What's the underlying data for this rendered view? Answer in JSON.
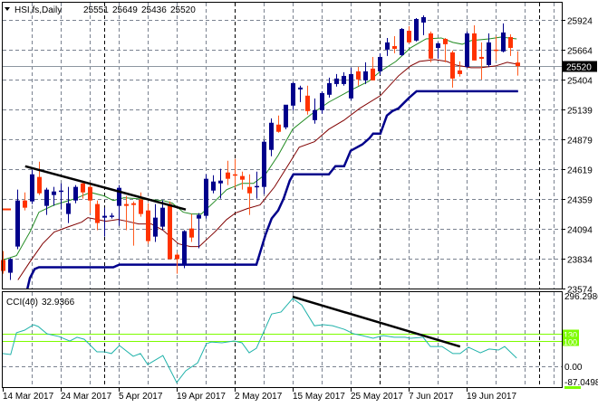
{
  "header": {
    "arrow_icon": "triangle-down-icon",
    "symbol": "HSI,fs,Daily",
    "open": "25551",
    "high": "25649",
    "low": "25436",
    "close": "25520"
  },
  "cci_label": {
    "name": "CCI(40)",
    "value": "32.9366"
  },
  "colors": {
    "bull": "#00008b",
    "bear": "#ff3300",
    "bear_wick": "#ff5a1e",
    "ma_fast": "#228b22",
    "ma_slow": "#800000",
    "stop": "#00008b",
    "cci": "#20b2aa",
    "levels": "#7cfc00",
    "trend": "#000000"
  },
  "chart_data": [
    {
      "type": "candlestick",
      "title": "HSI,fs,Daily",
      "ylim": [
        23574,
        25924
      ],
      "y_ticks": [
        "25924",
        "25664",
        "25404",
        "25139",
        "24879",
        "24619",
        "24359",
        "24094",
        "23834",
        "23574"
      ],
      "current_price_label": "25520",
      "current_price": 25520,
      "x_labels": [
        {
          "bar": 0,
          "label": "14 Mar 2017"
        },
        {
          "bar": 8,
          "label": "24 Mar 2017"
        },
        {
          "bar": 16,
          "label": "5 Apr 2017"
        },
        {
          "bar": 24,
          "label": "19 Apr 2017"
        },
        {
          "bar": 32,
          "label": "2 May 2017"
        },
        {
          "bar": 40,
          "label": "15 May 2017"
        },
        {
          "bar": 48,
          "label": "25 May 2017"
        },
        {
          "bar": 56,
          "label": "7 Jun 2017"
        },
        {
          "bar": 64,
          "label": "19 Jun 2017"
        }
      ],
      "candles_ohlc": [
        [
          23823,
          23902,
          23704,
          23728
        ],
        [
          23712,
          23839,
          23649,
          23831
        ],
        [
          23941,
          24439,
          23918,
          24344
        ],
        [
          24344,
          24415,
          24257,
          24281
        ],
        [
          24336,
          24613,
          24313,
          24573
        ],
        [
          24550,
          24684,
          24392,
          24407
        ],
        [
          24297,
          24455,
          24218,
          24439
        ],
        [
          24392,
          24463,
          24297,
          24423
        ],
        [
          24423,
          24494,
          24265,
          24431
        ],
        [
          24226,
          24463,
          24147,
          24320
        ],
        [
          24344,
          24479,
          24320,
          24463
        ],
        [
          24494,
          24518,
          24360,
          24415
        ],
        [
          24463,
          24502,
          24234,
          24344
        ],
        [
          24313,
          24344,
          24084,
          24147
        ],
        [
          24194,
          24281,
          24028,
          24210
        ],
        [
          24210,
          24234,
          24186,
          24212
        ],
        [
          24297,
          24479,
          24123,
          24455
        ],
        [
          24313,
          24384,
          24084,
          24297
        ],
        [
          24320,
          24336,
          23949,
          24305
        ],
        [
          24352,
          24415,
          24202,
          24226
        ],
        [
          24257,
          24320,
          23965,
          23989
        ],
        [
          24028,
          24313,
          23981,
          24194
        ],
        [
          24115,
          24344,
          24084,
          24281
        ],
        [
          24313,
          24336,
          23831,
          23831
        ],
        [
          23870,
          23886,
          23704,
          23831
        ],
        [
          23783,
          24084,
          23752,
          24076
        ],
        [
          24099,
          24226,
          23981,
          24020
        ],
        [
          24186,
          24234,
          23926,
          24218
        ],
        [
          24210,
          24573,
          24186,
          24534
        ],
        [
          24431,
          24565,
          24407,
          24510
        ],
        [
          24494,
          24621,
          24360,
          24518
        ],
        [
          24589,
          24692,
          24479,
          24534
        ],
        [
          24573,
          24708,
          24455,
          24565
        ],
        [
          24558,
          24597,
          24439,
          24526
        ],
        [
          24463,
          24573,
          24218,
          24407
        ],
        [
          24463,
          24597,
          24360,
          24471
        ],
        [
          24463,
          24874,
          24400,
          24858
        ],
        [
          24787,
          25063,
          24731,
          25024
        ],
        [
          25008,
          25087,
          24937,
          24945
        ],
        [
          24984,
          25047,
          24968,
          25182
        ],
        [
          25174,
          25379,
          25134,
          25371
        ],
        [
          25316,
          25348,
          25205,
          25332
        ],
        [
          25261,
          25348,
          25095,
          25126
        ],
        [
          25047,
          25237,
          25016,
          25134
        ],
        [
          25134,
          25300,
          25103,
          25284
        ],
        [
          25269,
          25419,
          25245,
          25371
        ],
        [
          25363,
          25450,
          25340,
          25411
        ],
        [
          25363,
          25466,
          25348,
          25434
        ],
        [
          25237,
          25506,
          25221,
          25450
        ],
        [
          25474,
          25513,
          25348,
          25403
        ],
        [
          25395,
          25553,
          25363,
          25474
        ],
        [
          25498,
          25600,
          25395,
          25395
        ],
        [
          25474,
          25632,
          25442,
          25600
        ],
        [
          25664,
          25766,
          25608,
          25727
        ],
        [
          25695,
          25782,
          25632,
          25671
        ],
        [
          25616,
          25853,
          25608,
          25845
        ],
        [
          25829,
          25869,
          25719,
          25727
        ],
        [
          25743,
          25940,
          25735,
          25932
        ],
        [
          25901,
          25964,
          25790,
          25948
        ],
        [
          25806,
          25822,
          25553,
          25585
        ],
        [
          25679,
          25727,
          25585,
          25719
        ],
        [
          25758,
          25766,
          25553,
          25711
        ],
        [
          25640,
          25656,
          25332,
          25411
        ],
        [
          25482,
          25561,
          25427,
          25450
        ],
        [
          25513,
          25822,
          25506,
          25806
        ],
        [
          25806,
          25877,
          25569,
          25569
        ],
        [
          25600,
          25727,
          25403,
          25584
        ],
        [
          25529,
          25806,
          25513,
          25727
        ],
        [
          25664,
          25782,
          25569,
          25656
        ],
        [
          25648,
          25893,
          25640,
          25814
        ],
        [
          25774,
          25798,
          25608,
          25679
        ],
        [
          25551,
          25649,
          25436,
          25520
        ]
      ],
      "ma_fast": [
        [
          0,
          23823
        ],
        [
          1.9,
          23862
        ],
        [
          3.75,
          24068
        ],
        [
          5,
          24242
        ],
        [
          7.1,
          24305
        ],
        [
          10,
          24360
        ],
        [
          12.1,
          24415
        ],
        [
          14,
          24384
        ],
        [
          15.25,
          24344
        ],
        [
          16.75,
          24368
        ],
        [
          18.4,
          24360
        ],
        [
          22.1,
          24344
        ],
        [
          23.4,
          24321
        ],
        [
          24.9,
          24242
        ],
        [
          26.1,
          24226
        ],
        [
          27.4,
          24226
        ],
        [
          29.25,
          24336
        ],
        [
          30.9,
          24439
        ],
        [
          33,
          24494
        ],
        [
          34.6,
          24494
        ],
        [
          36.25,
          24573
        ],
        [
          38,
          24739
        ],
        [
          40,
          24968
        ],
        [
          42.5,
          25095
        ],
        [
          45,
          25205
        ],
        [
          48,
          25308
        ],
        [
          50.5,
          25387
        ],
        [
          52.1,
          25474
        ],
        [
          54.25,
          25561
        ],
        [
          56.25,
          25679
        ],
        [
          58.4,
          25758
        ],
        [
          60.5,
          25766
        ],
        [
          62.1,
          25727
        ],
        [
          63.4,
          25711
        ],
        [
          64.6,
          25743
        ],
        [
          67.1,
          25758
        ],
        [
          68.75,
          25774
        ],
        [
          70.9,
          25758
        ]
      ],
      "ma_slow": [
        [
          2.1,
          23649
        ],
        [
          3.75,
          23807
        ],
        [
          5.5,
          23965
        ],
        [
          7.1,
          24068
        ],
        [
          8.75,
          24107
        ],
        [
          10.9,
          24155
        ],
        [
          11.75,
          24194
        ],
        [
          13,
          24178
        ],
        [
          14.25,
          24163
        ],
        [
          15.9,
          24178
        ],
        [
          17.1,
          24163
        ],
        [
          18.75,
          24139
        ],
        [
          20.5,
          24139
        ],
        [
          22.1,
          24084
        ],
        [
          24.25,
          23965
        ],
        [
          25.9,
          23941
        ],
        [
          27.1,
          23941
        ],
        [
          29.25,
          24068
        ],
        [
          30.9,
          24178
        ],
        [
          32.1,
          24234
        ],
        [
          33.75,
          24273
        ],
        [
          35.5,
          24305
        ],
        [
          37.5,
          24463
        ],
        [
          39.6,
          24676
        ],
        [
          40.9,
          24810
        ],
        [
          43,
          24858
        ],
        [
          45,
          24968
        ],
        [
          47.1,
          25047
        ],
        [
          49.25,
          25150
        ],
        [
          52.1,
          25261
        ],
        [
          54.6,
          25434
        ],
        [
          56.25,
          25521
        ],
        [
          57.5,
          25561
        ],
        [
          59.6,
          25577
        ],
        [
          61.25,
          25561
        ],
        [
          62.5,
          25529
        ],
        [
          64.6,
          25506
        ],
        [
          65.9,
          25506
        ],
        [
          68,
          25521
        ],
        [
          69.6,
          25553
        ],
        [
          70.9,
          25537
        ]
      ],
      "stop_line": [
        [
          3.1,
          23490
        ],
        [
          3.75,
          23665
        ],
        [
          4.4,
          23744
        ],
        [
          5,
          23760
        ],
        [
          15.25,
          23760
        ],
        [
          16.1,
          23783
        ],
        [
          35,
          23783
        ],
        [
          36.25,
          24044
        ],
        [
          37.1,
          24186
        ],
        [
          38,
          24257
        ],
        [
          38.75,
          24360
        ],
        [
          39.6,
          24518
        ],
        [
          40.1,
          24573
        ],
        [
          45,
          24573
        ],
        [
          45.9,
          24644
        ],
        [
          47.1,
          24644
        ],
        [
          48,
          24779
        ],
        [
          49.6,
          24834
        ],
        [
          50.6,
          24889
        ],
        [
          51.1,
          24929
        ],
        [
          52.1,
          24929
        ],
        [
          53,
          25087
        ],
        [
          53.75,
          25126
        ],
        [
          54.6,
          25150
        ],
        [
          56.1,
          25245
        ],
        [
          57.1,
          25300
        ],
        [
          71.1,
          25300
        ]
      ],
      "trendline": [
        [
          3.1,
          24644
        ],
        [
          25.25,
          24265
        ]
      ]
    },
    {
      "type": "line",
      "title": "CCI(40) 32.9366",
      "ylim": [
        -87.0498,
        296.2986
      ],
      "y_ticks": [
        "296.2986",
        "0.00",
        "-87.0498"
      ],
      "levels": [
        {
          "value": 130,
          "label": "130"
        },
        {
          "value": 100,
          "label": "100"
        }
      ],
      "values": [
        [
          0,
          51
        ],
        [
          1.1,
          47
        ],
        [
          1.9,
          134
        ],
        [
          3,
          144
        ],
        [
          4.25,
          166
        ],
        [
          4.9,
          159
        ],
        [
          6.1,
          130
        ],
        [
          7.75,
          119
        ],
        [
          9.25,
          101
        ],
        [
          10.25,
          116
        ],
        [
          11.25,
          108
        ],
        [
          13,
          58
        ],
        [
          14,
          58
        ],
        [
          15,
          51
        ],
        [
          16.1,
          83
        ],
        [
          18,
          40
        ],
        [
          19,
          51
        ],
        [
          20,
          7
        ],
        [
          22.1,
          43
        ],
        [
          24,
          -65
        ],
        [
          25.25,
          -18
        ],
        [
          26.9,
          14
        ],
        [
          28.1,
          90
        ],
        [
          28.75,
          97
        ],
        [
          30.25,
          94
        ],
        [
          31.9,
          101
        ],
        [
          33,
          94
        ],
        [
          34,
          54
        ],
        [
          35,
          72
        ],
        [
          36.1,
          144
        ],
        [
          37.1,
          209
        ],
        [
          38.4,
          217
        ],
        [
          40,
          271
        ],
        [
          41.25,
          245
        ],
        [
          43,
          162
        ],
        [
          44.25,
          166
        ],
        [
          45.5,
          162
        ],
        [
          47.1,
          148
        ],
        [
          48.4,
          130
        ],
        [
          49.6,
          123
        ],
        [
          51.1,
          112
        ],
        [
          52.5,
          123
        ],
        [
          54,
          116
        ],
        [
          55.5,
          116
        ],
        [
          56.25,
          112
        ],
        [
          58,
          116
        ],
        [
          59,
          79
        ],
        [
          60.6,
          79
        ],
        [
          62.1,
          51
        ],
        [
          63.1,
          51
        ],
        [
          64.25,
          76
        ],
        [
          65.9,
          54
        ],
        [
          67.1,
          69
        ],
        [
          68.4,
          65
        ],
        [
          69.25,
          79
        ],
        [
          70.9,
          33
        ]
      ],
      "trendline": [
        [
          40,
          278
        ],
        [
          63.1,
          79
        ]
      ]
    }
  ]
}
